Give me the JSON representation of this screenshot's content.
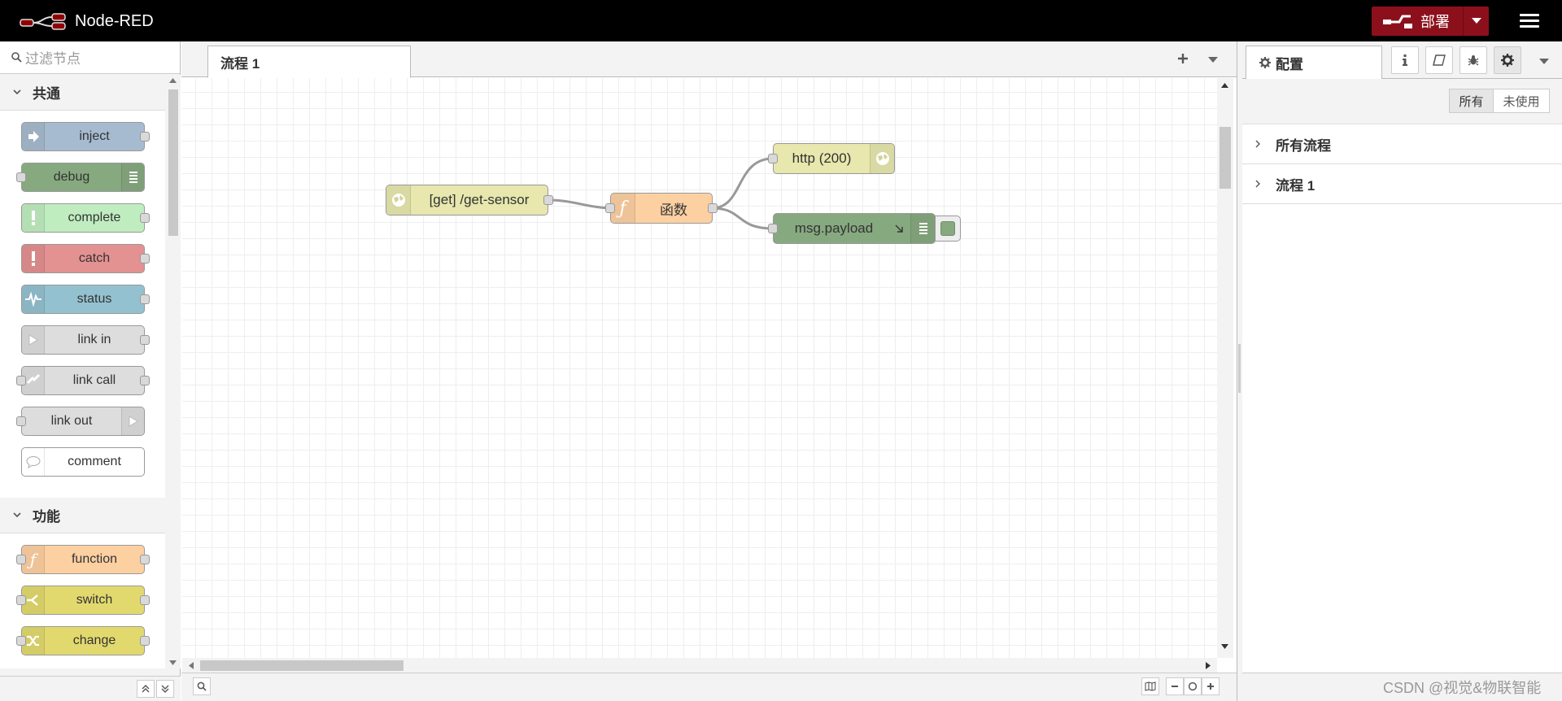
{
  "app": {
    "title": "Node-RED"
  },
  "header": {
    "deploy_label": "部署"
  },
  "palette": {
    "search_placeholder": "过滤节点",
    "categories": [
      {
        "title": "共通",
        "nodes": [
          {
            "label": "inject",
            "color": "#a6bbcf"
          },
          {
            "label": "debug",
            "color": "#87a980"
          },
          {
            "label": "complete",
            "color": "#c0edc0"
          },
          {
            "label": "catch",
            "color": "#e49191"
          },
          {
            "label": "status",
            "color": "#94c1d0"
          },
          {
            "label": "link in",
            "color": "#dddddd"
          },
          {
            "label": "link call",
            "color": "#dddddd"
          },
          {
            "label": "link out",
            "color": "#dddddd"
          },
          {
            "label": "comment",
            "color": "#ffffff"
          }
        ]
      },
      {
        "title": "功能",
        "nodes": [
          {
            "label": "function",
            "color": "#fdd0a2"
          },
          {
            "label": "switch",
            "color": "#e2d96e"
          },
          {
            "label": "change",
            "color": "#e2d96e"
          }
        ]
      }
    ]
  },
  "workspace": {
    "tabs": [
      {
        "label": "流程 1"
      }
    ],
    "nodes": [
      {
        "label": "[get] /get-sensor",
        "type": "http in",
        "color": "#e7e7ae"
      },
      {
        "label": "函数",
        "type": "function",
        "color": "#fdd0a2"
      },
      {
        "label": "http (200)",
        "type": "http response",
        "color": "#e7e7ae"
      },
      {
        "label": "msg.payload",
        "type": "debug",
        "color": "#87a980"
      }
    ]
  },
  "sidebar": {
    "tab_label": "配置",
    "filters": {
      "all": "所有",
      "unused": "未使用"
    },
    "sections": [
      {
        "label": "所有流程"
      },
      {
        "label": "流程 1"
      }
    ]
  },
  "watermark": "CSDN @视觉&物联智能",
  "colors": {
    "header_bg": "#000000",
    "deploy_bg": "#8c101c"
  }
}
